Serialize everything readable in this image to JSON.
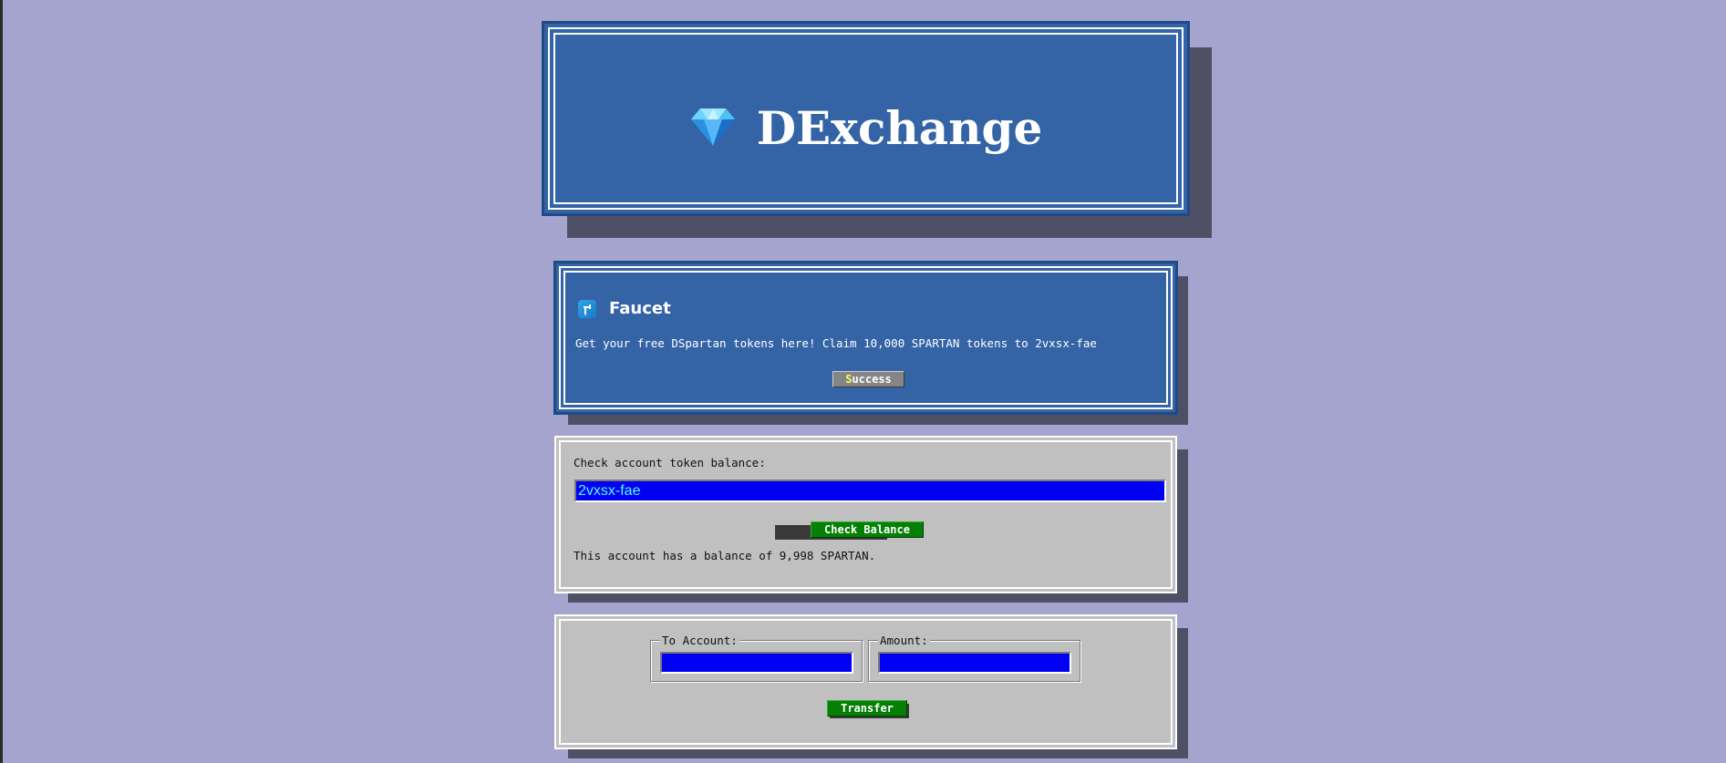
{
  "header": {
    "title": "DExchange",
    "logo_icon": "gem-icon"
  },
  "faucet": {
    "title": "Faucet",
    "icon": "faucet-icon",
    "description": "Get your free DSpartan tokens here! Claim 10,000 SPARTAN tokens to 2vxsx-fae",
    "button_hotkey": "S",
    "button_rest": "uccess"
  },
  "balance": {
    "label": "Check account token balance:",
    "account_value": "2vxsx-fae",
    "button_label": "Check Balance",
    "result_text": "This account has a balance of 9,998 SPARTAN."
  },
  "transfer": {
    "to_account_label": "To Account:",
    "to_account_value": "",
    "amount_label": "Amount:",
    "amount_value": "",
    "button_label": "Transfer"
  },
  "colors": {
    "page_background": "#a4a4cf",
    "panel_blue": "#3464a6",
    "panel_gray": "#c0c0c0",
    "input_blue": "#0000f2",
    "input_text": "#55ffff",
    "button_green": "#058005",
    "button_gray": "#858585"
  }
}
